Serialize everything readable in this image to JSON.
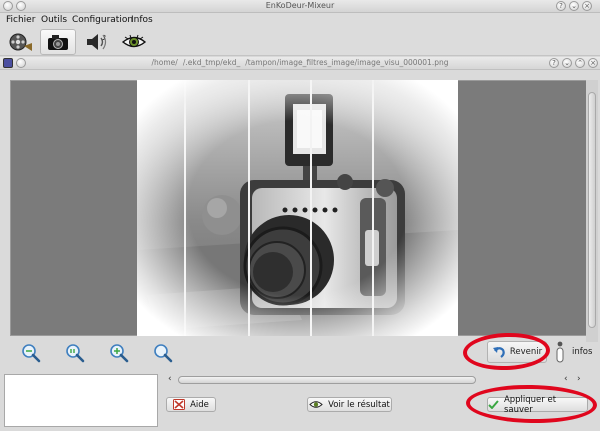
{
  "app": {
    "title": "EnKoDeur-Mixeur"
  },
  "menu": {
    "items": [
      "Fichier",
      "Outils",
      "Configuration",
      "Infos"
    ]
  },
  "toolbar": {
    "icons": [
      "film-reel-icon",
      "camera-icon",
      "speaker-icon",
      "eye-icon"
    ],
    "active": 1
  },
  "preview": {
    "path": "/home/    /.ekd_tmp/ekd_    /tampon/image_filtres_image/image_visu_000001.png",
    "zoom_buttons": [
      "zoom-fit-icon",
      "zoom-100-icon",
      "zoom-in-icon",
      "zoom-out-icon"
    ]
  },
  "actions": {
    "revenir": "Revenir",
    "infos": "infos",
    "aide": "Aide",
    "voir": "Voir le résultat",
    "appliquer": "Appliquer et sauver"
  },
  "colors": {
    "annotation": "#e0061d",
    "accent_check": "#3aa642"
  }
}
